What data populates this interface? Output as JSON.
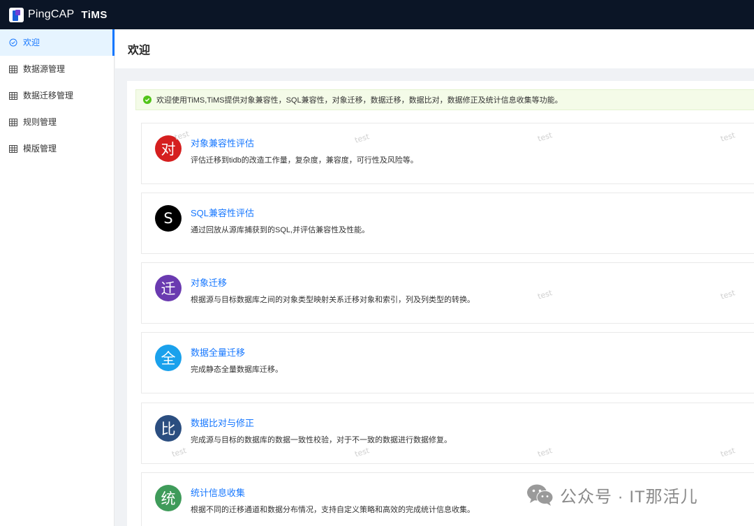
{
  "app": {
    "brand": "PingCAP",
    "product": "TiMS",
    "accent_color": "#1677ff",
    "topbar_color": "#0b1526"
  },
  "sidebar": {
    "items": [
      {
        "label": "欢迎",
        "icon": "check-circle-icon",
        "active": true
      },
      {
        "label": "数据源管理",
        "icon": "table-icon",
        "active": false
      },
      {
        "label": "数据迁移管理",
        "icon": "table-icon",
        "active": false
      },
      {
        "label": "规则管理",
        "icon": "table-icon",
        "active": false
      },
      {
        "label": "模版管理",
        "icon": "table-icon",
        "active": false
      }
    ]
  },
  "header": {
    "title": "欢迎"
  },
  "alert": {
    "icon": "check-circle-filled-icon",
    "color": "#52c41a",
    "text": "欢迎使用TiMS,TiMS提供对象兼容性，SQL兼容性，对象迁移，数据迁移，数据比对，数据修正及统计信息收集等功能。"
  },
  "cards": [
    {
      "avatar": "对",
      "avatar_color": "#d51f1f",
      "title": "对象兼容性评估",
      "desc": "评估迁移到tidb的改造工作量，复杂度，兼容度，可行性及风险等。"
    },
    {
      "avatar": "S",
      "avatar_color": "#000000",
      "title": "SQL兼容性评估",
      "desc": "通过回放从源库捕获到的SQL,并评估兼容性及性能。"
    },
    {
      "avatar": "迁",
      "avatar_color": "#6a3ab0",
      "title": "对象迁移",
      "desc": "根据源与目标数据库之间的对象类型映射关系迁移对象和索引，列及列类型的转换。"
    },
    {
      "avatar": "全",
      "avatar_color": "#1aa1ec",
      "title": "数据全量迁移",
      "desc": "完成静态全量数据库迁移。"
    },
    {
      "avatar": "比",
      "avatar_color": "#2b4e80",
      "title": "数据比对与修正",
      "desc": "完成源与目标的数据库的数据一致性校验，对于不一致的数据进行数据修复。"
    },
    {
      "avatar": "统",
      "avatar_color": "#3f9b5a",
      "title": "统计信息收集",
      "desc": "根据不同的迁移通道和数据分布情况，支持自定义策略和高效的完成统计信息收集。"
    }
  ],
  "watermark": {
    "text": "test"
  },
  "footer_watermark": {
    "icon": "wechat-icon",
    "text": "公众号 · IT那活儿"
  }
}
